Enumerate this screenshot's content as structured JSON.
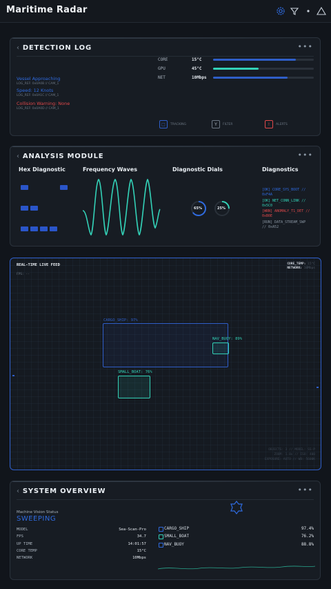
{
  "app": {
    "title": "Maritime Radar"
  },
  "header_icons": [
    "gear-icon",
    "filter-icon",
    "dot-icon",
    "alert-triangle-icon"
  ],
  "colors": {
    "accent_blue": "#2f6be0",
    "teal": "#33d1b7",
    "red": "#e0484a",
    "bg": "#11151b"
  },
  "detection_log": {
    "title": "DETECTION LOG",
    "entries": [
      {
        "msg": "Vessel Approaching",
        "meta": "LOG_REF: 0x0A0B // CAM_1",
        "color": "#2f6be0"
      },
      {
        "msg": "Speed: 12 Knots",
        "meta": "LOG_REF: 0x0A1C // CAM_1",
        "color": "#2f6be0"
      },
      {
        "msg": "Collision Warning: None",
        "meta": "LOG_REF: 0x0A0D // CAM_1",
        "color": "#e0484a"
      }
    ],
    "stats": [
      {
        "label": "CORE",
        "value": "15°C",
        "fill": 0.82,
        "color": "#2f5ec8"
      },
      {
        "label": "GPU",
        "value": "45°C",
        "fill": 0.45,
        "color": "#33d1b7"
      },
      {
        "label": "NET",
        "value": "10Mbps",
        "fill": 0.74,
        "color": "#2f5ec8"
      }
    ],
    "filters": [
      {
        "label": "TRACKING",
        "glyph": "□",
        "color": "#2f5ec8"
      },
      {
        "label": "FILTER",
        "glyph": "Y",
        "color": "#8a96a3"
      },
      {
        "label": "ALERTS",
        "glyph": "!",
        "color": "#e0484a"
      }
    ]
  },
  "analysis": {
    "title": "ANALYSIS MODULE",
    "headings": {
      "hex": "Hex Diagnostic",
      "freq": "Frequency Waves",
      "dials": "Diagnostic Dials",
      "diag": "Diagnostics"
    },
    "dials": [
      {
        "label": "65%",
        "value": 0.65,
        "color": "#2f6be0"
      },
      {
        "label": "25%",
        "value": 0.25,
        "color": "#33d1b7"
      }
    ],
    "diag_lines": [
      {
        "text": "[OK] CORE_SYS_BOOT // 0xF4A",
        "color": "#2f6be0"
      },
      {
        "text": "[OK] NET_CONN_LINK // 0x5C0",
        "color": "#33d1b7"
      },
      {
        "text": "[WRN] ANOMALY_T1_DET // 0xB0E",
        "color": "#e0484a"
      },
      {
        "text": "[RUN] DATA_STREAM_SWP // 0xA52",
        "color": "#8a96a3"
      }
    ]
  },
  "live_feed": {
    "title": "REAL-TIME LIVE FEED",
    "fps_label": "FPS: --",
    "status": {
      "core_label": "CORE_TEMP:",
      "core_val": "15°C",
      "net_label": "NETWORK:",
      "net_val": "10Mbps"
    },
    "detections": [
      {
        "label": "CARGO_SHIP: 97%",
        "color": "#2f5ec8"
      },
      {
        "label": "NAV_BUOY: 89%",
        "color": "#33d1b7"
      },
      {
        "label": "SMALL_BOAT: 76%",
        "color": "#33d1b7"
      }
    ],
    "footer": [
      "OBJECTS: 3 // MODEL: SS-P",
      "ZOOM: 1.0x // ISO: 400",
      "EXPOSURE: AUTO // WB: 5600K"
    ]
  },
  "overview": {
    "title": "SYSTEM OVERVIEW",
    "status_label": "Machine Vision Status",
    "status_value": "SWEEPING",
    "kv": [
      {
        "k": "MODEL",
        "v": "Sea-Scan-Pro"
      },
      {
        "k": "FPS",
        "v": "34.7"
      },
      {
        "k": "UP TIME",
        "v": "14:01:57"
      },
      {
        "k": "CORE TEMP",
        "v": "15°C"
      },
      {
        "k": "NETWORK",
        "v": "10Mbps"
      }
    ],
    "classes": [
      {
        "name": "CARGO_SHIP",
        "value": "97.4%",
        "color": "#2f6be0"
      },
      {
        "name": "SMALL_BOAT",
        "value": "76.2%",
        "color": "#33d1b7"
      },
      {
        "name": "NAV_BUOY",
        "value": "88.8%",
        "color": "#2f6be0"
      }
    ]
  }
}
